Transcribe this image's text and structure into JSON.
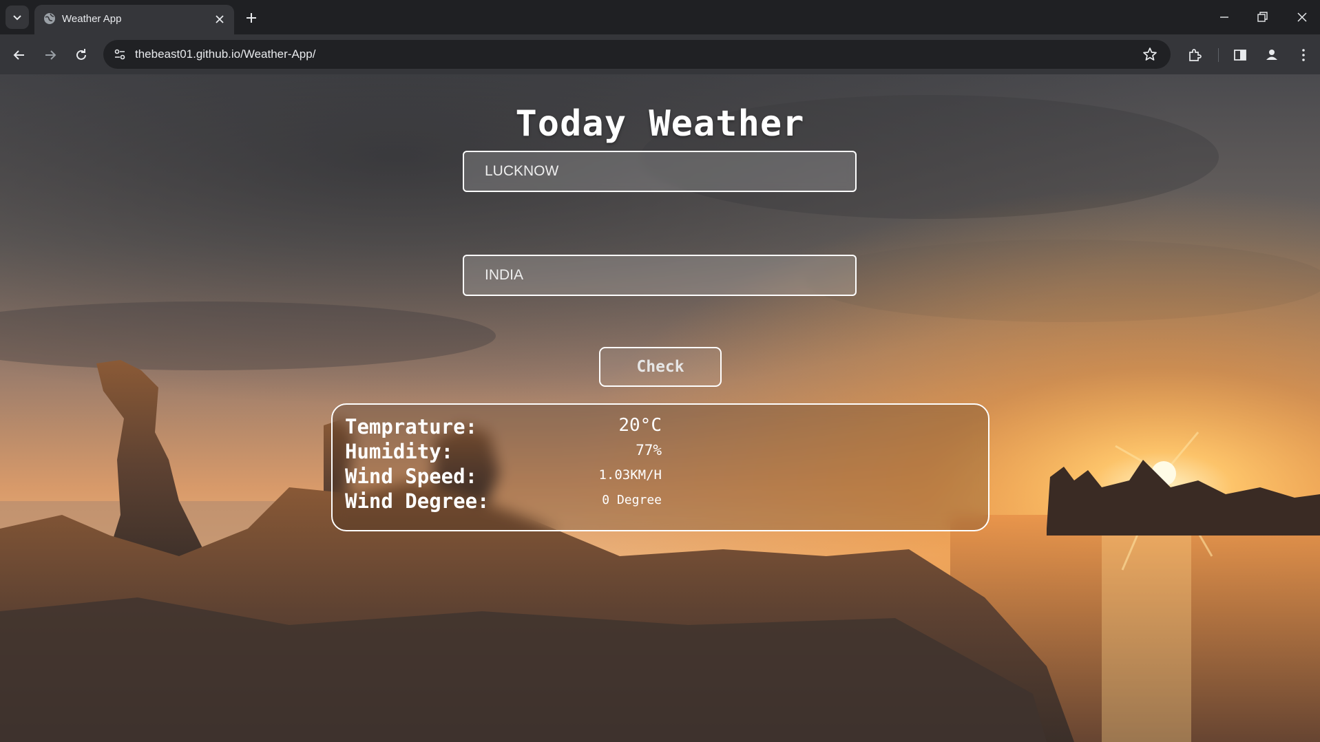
{
  "browser": {
    "tab_title": "Weather App",
    "url": "thebeast01.github.io/Weather-App/"
  },
  "icons": {
    "tab_search": "chevron-down-icon",
    "favicon": "globe-icon",
    "tab_close": "close-icon",
    "new_tab": "plus-icon",
    "back": "back-arrow-icon",
    "forward": "forward-arrow-icon",
    "reload": "reload-icon",
    "site_info": "tune-icon",
    "bookmark": "star-icon",
    "extensions": "puzzle-icon",
    "side_panel": "side-panel-icon",
    "profile": "person-icon",
    "menu": "kebab-menu-icon",
    "minimize": "minimize-icon",
    "restore": "restore-icon",
    "close_window": "close-window-icon"
  },
  "app": {
    "title": "Today Weather",
    "city_value": "LUCKNOW",
    "country_value": "INDIA",
    "check_label": "Check",
    "results": [
      {
        "label": "Temprature:",
        "value": "20°C"
      },
      {
        "label": "Humidity:",
        "value": "77%"
      },
      {
        "label": "Wind Speed:",
        "value": "1.03KM/H"
      },
      {
        "label": "Wind Degree:",
        "value": "0 Degree"
      }
    ]
  },
  "colors": {
    "chrome_dark": "#1f2023",
    "toolbar": "#35363a",
    "text_white": "#ffffff",
    "sunset_orange": "#f39a3e"
  }
}
